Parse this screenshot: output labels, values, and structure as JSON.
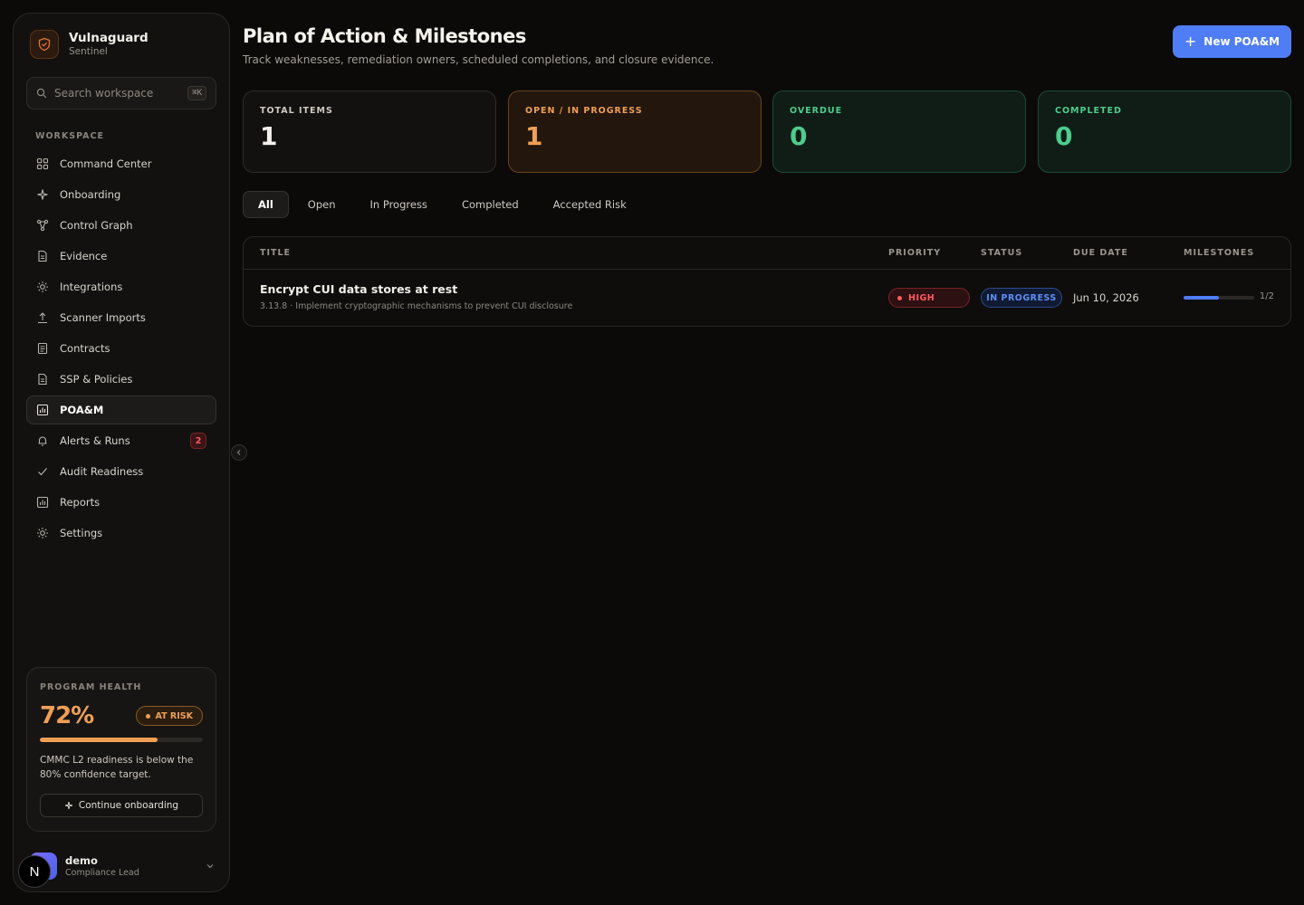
{
  "brand": {
    "name": "Vulnaguard",
    "subtitle": "Sentinel"
  },
  "search": {
    "placeholder": "Search workspace",
    "shortcut": "⌘K"
  },
  "sidebar": {
    "section_label": "WORKSPACE",
    "items": [
      {
        "label": "Command Center",
        "icon": "grid-icon"
      },
      {
        "label": "Onboarding",
        "icon": "sparkle-icon"
      },
      {
        "label": "Control Graph",
        "icon": "graph-icon"
      },
      {
        "label": "Evidence",
        "icon": "document-icon"
      },
      {
        "label": "Integrations",
        "icon": "sun-icon"
      },
      {
        "label": "Scanner Imports",
        "icon": "upload-icon"
      },
      {
        "label": "Contracts",
        "icon": "file-text-icon"
      },
      {
        "label": "SSP & Policies",
        "icon": "document-icon"
      },
      {
        "label": "POA&M",
        "icon": "chart-icon",
        "active": true
      },
      {
        "label": "Alerts & Runs",
        "icon": "bell-icon",
        "badge": "2"
      },
      {
        "label": "Audit Readiness",
        "icon": "check-icon"
      },
      {
        "label": "Reports",
        "icon": "chart-icon"
      },
      {
        "label": "Settings",
        "icon": "gear-icon"
      }
    ]
  },
  "health": {
    "label": "PROGRAM HEALTH",
    "value": "72%",
    "percent": 72,
    "status": "AT RISK",
    "description": "CMMC L2 readiness is below the 80% confidence target.",
    "cta": "Continue onboarding"
  },
  "user": {
    "name": "demo",
    "role": "Compliance Lead",
    "badge": "N"
  },
  "page": {
    "title": "Plan of Action & Milestones",
    "subtitle": "Track weaknesses, remediation owners, scheduled completions, and closure evidence.",
    "new_button": "New POA&M"
  },
  "stats": [
    {
      "label": "TOTAL ITEMS",
      "value": "1"
    },
    {
      "label": "OPEN / IN PROGRESS",
      "value": "1"
    },
    {
      "label": "OVERDUE",
      "value": "0"
    },
    {
      "label": "COMPLETED",
      "value": "0"
    }
  ],
  "tabs": [
    "All",
    "Open",
    "In Progress",
    "Completed",
    "Accepted Risk"
  ],
  "table": {
    "columns": [
      "TITLE",
      "PRIORITY",
      "STATUS",
      "DUE DATE",
      "MILESTONES"
    ],
    "rows": [
      {
        "title": "Encrypt CUI data stores at rest",
        "subtitle": "3.13.8 · Implement cryptographic mechanisms to prevent CUI disclosure",
        "priority": "HIGH",
        "status": "IN PROGRESS",
        "due": "Jun 10, 2026",
        "milestones": "1/2",
        "milestone_fraction": 0.5
      }
    ]
  },
  "colors": {
    "accent": "#4f7df5",
    "warning": "#f0a055",
    "success": "#4ecc8c",
    "danger": "#ff5a5f"
  }
}
